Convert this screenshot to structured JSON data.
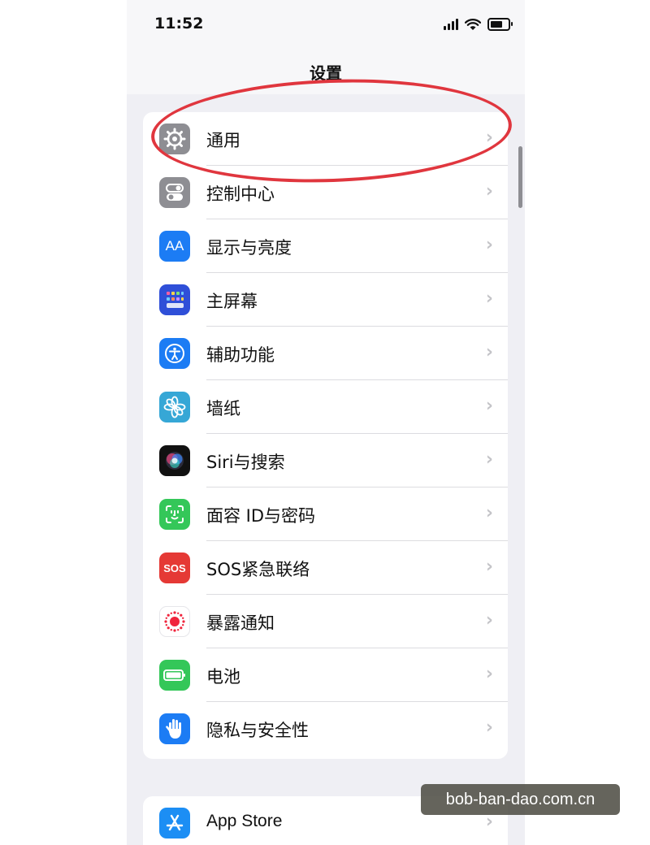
{
  "status_bar": {
    "time": "11:52"
  },
  "nav": {
    "title": "设置"
  },
  "settings_group": [
    {
      "label": "通用",
      "icon": "gear-icon",
      "color": "#8e8e93"
    },
    {
      "label": "控制中心",
      "icon": "toggle-switches-icon",
      "color": "#8e8e93"
    },
    {
      "label": "显示与亮度",
      "icon": "text-size-icon",
      "color": "#1c7cf4",
      "glyph": "AA"
    },
    {
      "label": "主屏幕",
      "icon": "home-grid-icon",
      "color": "#2f4fd8"
    },
    {
      "label": "辅助功能",
      "icon": "accessibility-icon",
      "color": "#1c7cf4"
    },
    {
      "label": "墙纸",
      "icon": "flower-icon",
      "color": "#36a7d6"
    },
    {
      "label": "Siri与搜索",
      "icon": "siri-icon",
      "color": "#111111"
    },
    {
      "label": "面容 ID与密码",
      "icon": "face-id-icon",
      "color": "#34c759"
    },
    {
      "label": "SOS紧急联络",
      "icon": "sos-icon",
      "color": "#e53935",
      "glyph": "SOS"
    },
    {
      "label": "暴露通知",
      "icon": "exposure-dots-icon",
      "color": "#ffffff"
    },
    {
      "label": "电池",
      "icon": "battery-icon",
      "color": "#34c759"
    },
    {
      "label": "隐私与安全性",
      "icon": "hand-icon",
      "color": "#1c7cf4"
    }
  ],
  "store_group": [
    {
      "label": "App Store",
      "icon": "app-store-icon",
      "color": "#1c8ef4"
    }
  ],
  "watermark": "bob-ban-dao.com.cn"
}
